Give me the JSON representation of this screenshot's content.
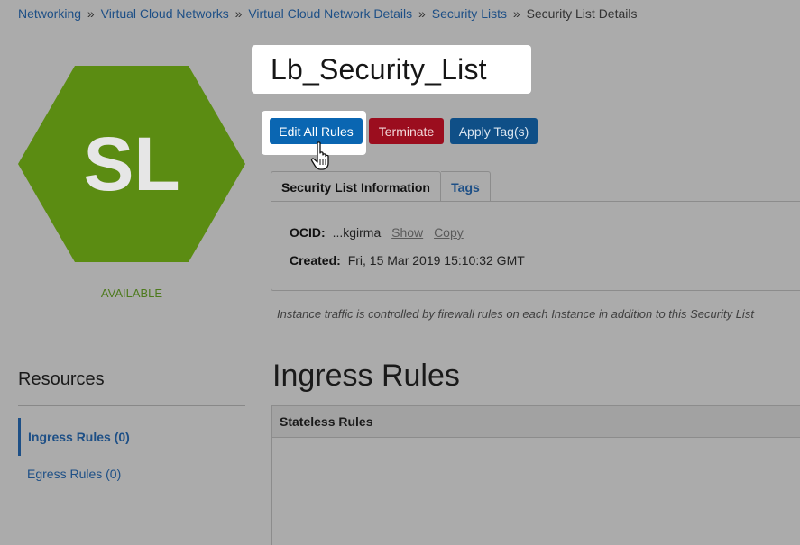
{
  "breadcrumb": {
    "items": [
      "Networking",
      "Virtual Cloud Networks",
      "Virtual Cloud Network Details",
      "Security Lists"
    ],
    "separator": "»",
    "current": "Security List Details"
  },
  "resource_icon": {
    "initials": "SL",
    "status": "AVAILABLE",
    "color": "#5b8c12"
  },
  "title": "Lb_Security_List",
  "actions": {
    "edit_all_rules": "Edit All Rules",
    "terminate": "Terminate",
    "apply_tags": "Apply Tag(s)"
  },
  "tabs": {
    "info": "Security List Information",
    "tags": "Tags"
  },
  "info": {
    "ocid_label": "OCID:",
    "ocid_value": "...kgirma",
    "show_link": "Show",
    "copy_link": "Copy",
    "created_label": "Created:",
    "created_value": "Fri, 15 Mar 2019 15:10:32 GMT"
  },
  "note": "Instance traffic is controlled by firewall rules on each Instance in addition to this Security List",
  "resources": {
    "title": "Resources",
    "items": [
      {
        "label": "Ingress Rules (0)",
        "active": true
      },
      {
        "label": "Egress Rules (0)",
        "active": false
      }
    ]
  },
  "ingress": {
    "title": "Ingress Rules",
    "table_header": "Stateless Rules"
  },
  "colors": {
    "link": "#1d4f86",
    "primary_button": "#0a66b2",
    "danger_button": "#9b0d1e",
    "secondary_button": "#0f4f87",
    "status_available": "#4d7a1d",
    "overlay_background": "#ababab"
  }
}
